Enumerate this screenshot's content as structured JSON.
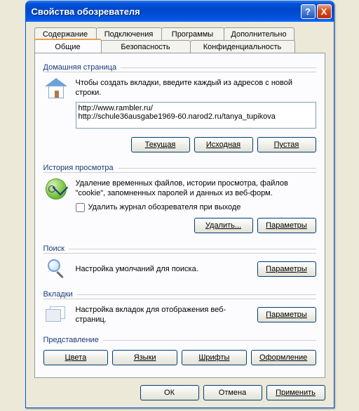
{
  "window": {
    "title": "Свойства обозревателя"
  },
  "titlebar": {
    "help": "?",
    "close": "X"
  },
  "tabs": {
    "row1": [
      "Содержание",
      "Подключения",
      "Программы",
      "Дополнительно"
    ],
    "row2": [
      "Общие",
      "Безопасность",
      "Конфиденциальность"
    ],
    "active": "Общие"
  },
  "home": {
    "title": "Домашняя страница",
    "desc": "Чтобы создать вкладки, введите каждый из адресов с новой строки.",
    "urls": "http://www.rambler.ru/\nhttp://schule36ausgabe1969-60.narod2.ru/tanya_tupikova",
    "btn_current": "Текущая",
    "btn_default": "Исходная",
    "btn_blank": "Пустая"
  },
  "history": {
    "title": "История просмотра",
    "desc": "Удаление временных файлов, истории просмотра, файлов \"cookie\", запомненных паролей и данных из веб-форм.",
    "chk": "Удалить журнал обозревателя при выходе",
    "btn_delete": "Удалить...",
    "btn_params": "Параметры"
  },
  "search": {
    "title": "Поиск",
    "desc": "Настройка умолчаний для поиска.",
    "btn_params": "Параметры"
  },
  "tabsec": {
    "title": "Вкладки",
    "desc": "Настройка вкладок для отображения веб-страниц.",
    "btn_params": "Параметры"
  },
  "appearance": {
    "title": "Представление",
    "btn_colors": "Цвета",
    "btn_langs": "Языки",
    "btn_fonts": "Шрифты",
    "btn_style": "Оформление"
  },
  "dialog": {
    "ok": "ОК",
    "cancel": "Отмена",
    "apply": "Применить"
  }
}
